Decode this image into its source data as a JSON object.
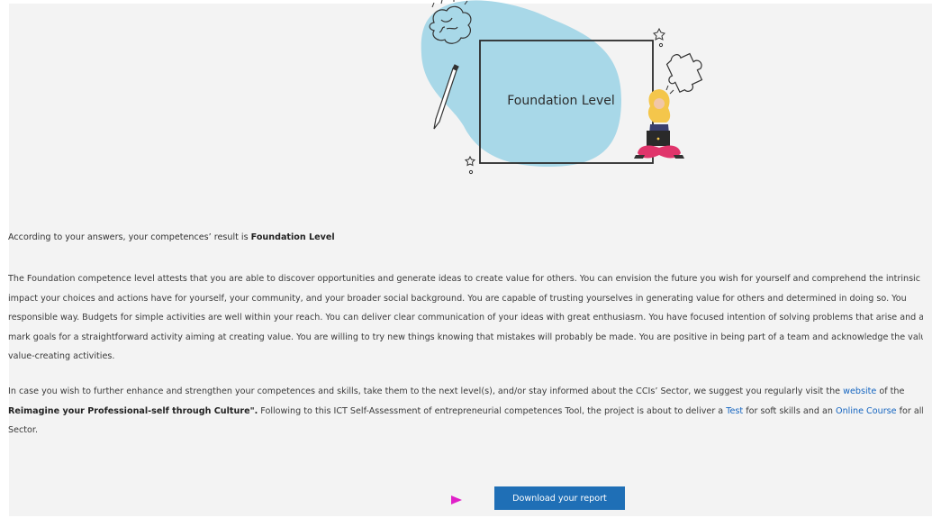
{
  "illustration": {
    "label": "Foundation Level"
  },
  "result": {
    "prefix": "According to your answers, your competences’ result is ",
    "level": "Foundation Level"
  },
  "paragraph1": {
    "lines": [
      "The Foundation competence level attests that you are able to discover opportunities and generate ideas to create value for others. You can envision the future you wish for yourself and comprehend the intrinsic",
      "impact your choices and actions have for yourself, your community, and your broader social background. You are capable of trusting yourselves in generating value for others and determined in doing so. You",
      "responsible way. Budgets for simple activities are well within your reach. You can deliver clear communication of your ideas with great enthusiasm. You have focused intention of solving problems that arise and at",
      "mark goals for a straightforward activity aiming at creating value. You are willing to try new things knowing that mistakes will probably be made. You are positive in being part of a team and acknowledge the valuab",
      "value-creating activities."
    ]
  },
  "paragraph2": {
    "line1_text": "In case you wish to further enhance and strengthen your competences and skills, take them to the next level(s), and/or stay informed about the CCIs’ Sector, we suggest you regularly visit the ",
    "website_link": "website",
    "line1_tail": " of the",
    "line2_bold": "Reimagine your Professional-self through Culture\".",
    "line2_text": " Following to this ICT Self-Assessment of entrepreneurial competences Tool, the project is about to deliver a ",
    "test_link": "Test",
    "line2_mid": " for soft skills and an ",
    "course_link": "Online Course",
    "line2_tail": " for all new or",
    "line3_text": "Sector."
  },
  "download_button": {
    "label": "Download your report"
  },
  "colors": {
    "page_bg": "#f3f3f3",
    "blob": "#a8d8e8",
    "button_bg": "#1f6fb6",
    "link": "#1565c0",
    "cursor": "#e020c8"
  }
}
